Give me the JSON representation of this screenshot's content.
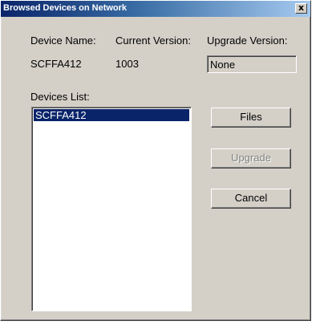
{
  "window": {
    "title": "Browsed Devices on Network",
    "close_glyph": "x"
  },
  "header": {
    "device_name_label": "Device Name:",
    "current_version_label": "Current Version:",
    "upgrade_version_label": "Upgrade Version:",
    "device_name_value": "SCFFA412",
    "current_version_value": "1003",
    "upgrade_version_value": "None"
  },
  "devices": {
    "label": "Devices List:",
    "items": [
      "SCFFA412"
    ],
    "selected_index": 0
  },
  "buttons": {
    "files_label": "Files",
    "upgrade_label": "Upgrade",
    "upgrade_enabled": false,
    "cancel_label": "Cancel"
  },
  "colors": {
    "title_bar": "#0a246a",
    "selection": "#0a246a",
    "dialog_face": "#d4d0c8"
  },
  "icons": {
    "close": "close-icon"
  }
}
